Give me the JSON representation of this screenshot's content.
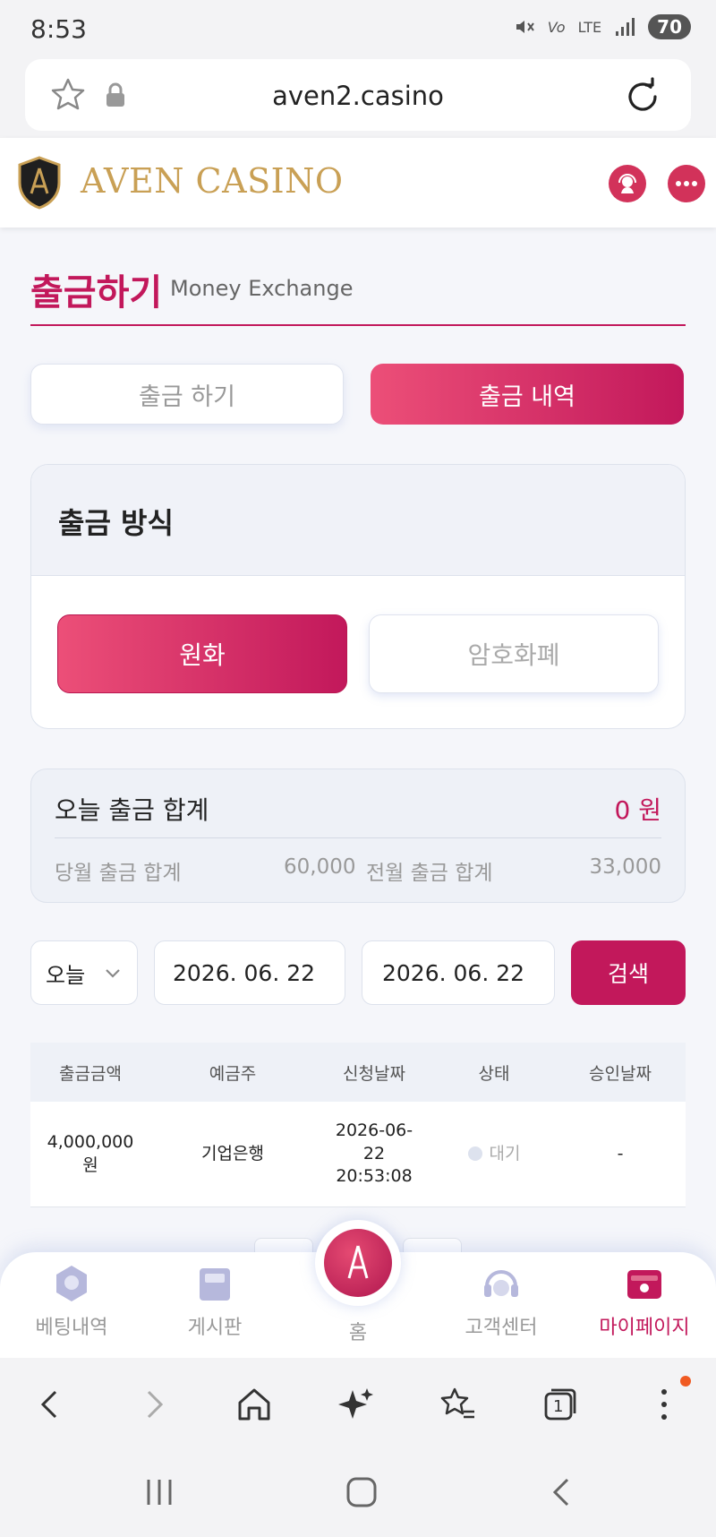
{
  "status_bar": {
    "time": "8:53",
    "network": "LTE",
    "battery": "70"
  },
  "browser": {
    "url": "aven2.casino",
    "tab_count": "1"
  },
  "header": {
    "brand": "AVEN CASINO"
  },
  "page": {
    "title": "출금하기",
    "subtitle": "Money Exchange"
  },
  "tabs": [
    {
      "label": "출금 하기",
      "active": false
    },
    {
      "label": "출금 내역",
      "active": true
    }
  ],
  "method": {
    "title": "출금 방식",
    "options": [
      {
        "label": "원화",
        "active": true
      },
      {
        "label": "암호화폐",
        "active": false
      }
    ]
  },
  "summary": {
    "today_label": "오늘 출금 합계",
    "today_value": "0 원",
    "month_label": "당월 출금 합계",
    "month_value": "60,000",
    "prev_label": "전월 출금 합계",
    "prev_value": "33,000"
  },
  "filter": {
    "period": "오늘",
    "start_date": "2026. 06. 22",
    "end_date": "2026. 06. 22",
    "search_label": "검색"
  },
  "table": {
    "headers": [
      "출금금액",
      "예금주",
      "신청날짜",
      "상태",
      "승인날짜"
    ],
    "rows": [
      {
        "amount_line1": "4,000,000",
        "amount_line2": "원",
        "holder": "기업은행",
        "date_line1": "2026-06-",
        "date_line2": "22",
        "date_line3": "20:53:08",
        "status": "대기",
        "approved": "-"
      }
    ]
  },
  "bottom_nav": {
    "bets": "베팅내역",
    "board": "게시판",
    "home": "홈",
    "support": "고객센터",
    "mypage": "마이페이지"
  },
  "colors": {
    "accent": "#c2185b",
    "gold": "#c9a055",
    "bg": "#f5f6fa"
  }
}
